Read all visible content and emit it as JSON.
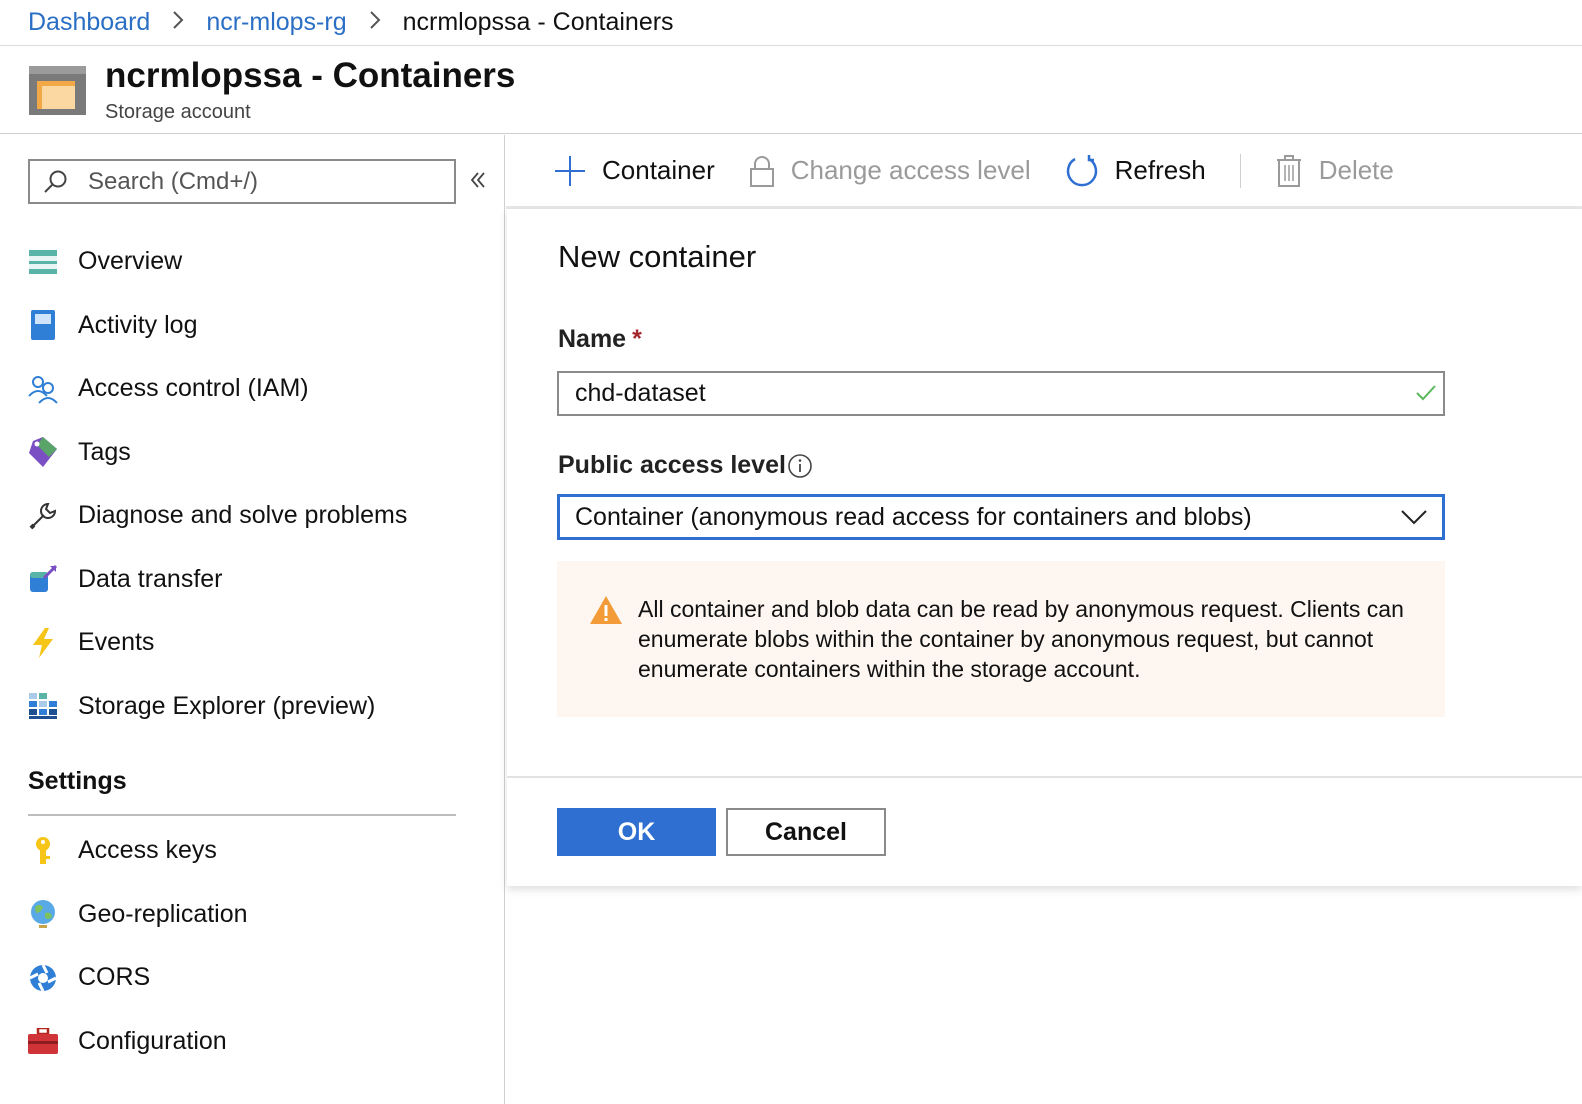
{
  "breadcrumb": {
    "items": [
      "Dashboard",
      "ncr-mlops-rg"
    ],
    "current": "ncrmlopssa - Containers",
    "separator": ">"
  },
  "header": {
    "title": "ncrmlopssa - Containers",
    "subtitle": "Storage account",
    "icon": "storage-account-icon"
  },
  "sidebar": {
    "search_placeholder": "Search (Cmd+/)",
    "collapse_label": "«",
    "items": [
      {
        "label": "Overview",
        "icon": "overview-icon"
      },
      {
        "label": "Activity log",
        "icon": "activity-log-icon"
      },
      {
        "label": "Access control (IAM)",
        "icon": "iam-people-icon"
      },
      {
        "label": "Tags",
        "icon": "tag-icon"
      },
      {
        "label": "Diagnose and solve problems",
        "icon": "wrench-icon"
      },
      {
        "label": "Data transfer",
        "icon": "data-transfer-icon"
      },
      {
        "label": "Events",
        "icon": "lightning-icon"
      },
      {
        "label": "Storage Explorer (preview)",
        "icon": "storage-explorer-icon"
      }
    ],
    "settings_header": "Settings",
    "settings_items": [
      {
        "label": "Access keys",
        "icon": "key-icon"
      },
      {
        "label": "Geo-replication",
        "icon": "globe-icon"
      },
      {
        "label": "CORS",
        "icon": "cors-icon"
      },
      {
        "label": "Configuration",
        "icon": "toolbox-icon"
      }
    ]
  },
  "toolbar": {
    "container_label": "Container",
    "change_access_label": "Change access level",
    "refresh_label": "Refresh",
    "delete_label": "Delete"
  },
  "panel": {
    "title": "New container",
    "name_label": "Name",
    "required_marker": "*",
    "name_value": "chd-dataset",
    "access_label": "Public access level",
    "access_value": "Container (anonymous read access for containers and blobs)",
    "warning_text": "All container and blob data can be read by anonymous request. Clients can enumerate blobs within the container by anonymous request, but cannot enumerate containers within the storage account.",
    "ok_label": "OK",
    "cancel_label": "Cancel"
  },
  "colors": {
    "accent": "#2f6fd1",
    "link": "#2b6fc5",
    "warning": "#f29b38",
    "warning_bg": "#fdf6f1",
    "valid": "#5cb85c"
  }
}
